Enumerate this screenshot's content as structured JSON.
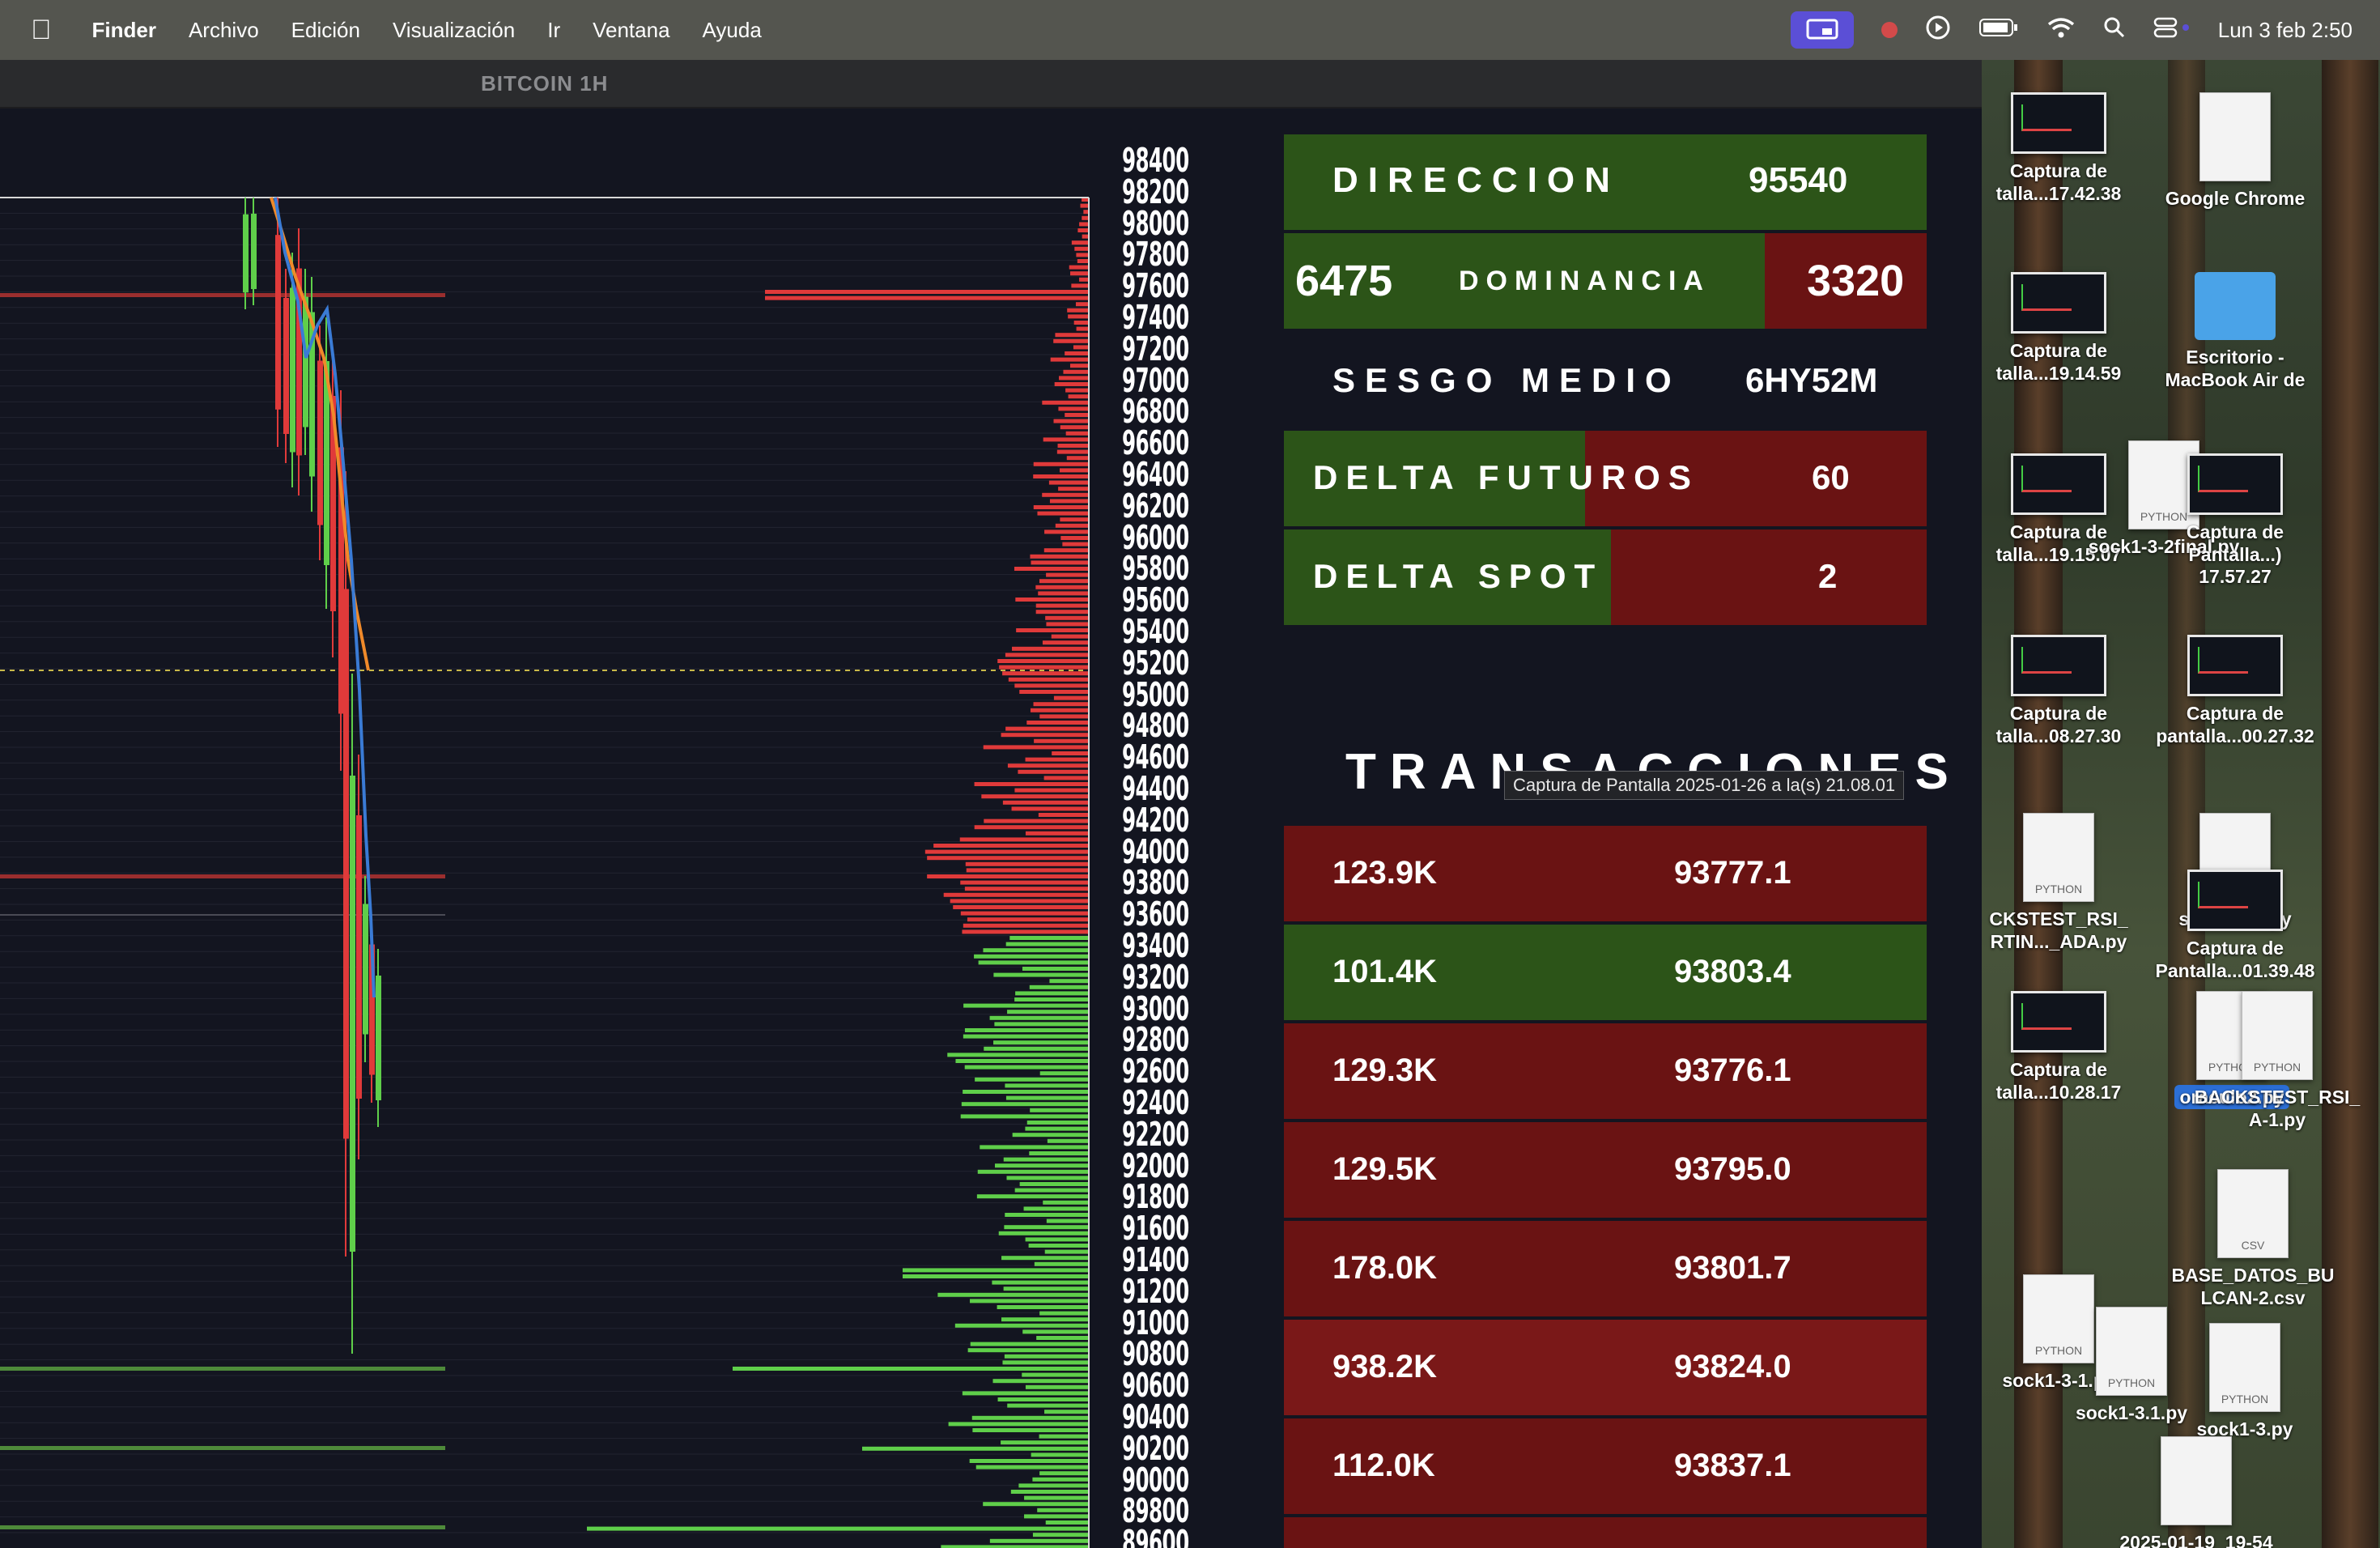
{
  "menubar": {
    "apple": "",
    "items": [
      "Finder",
      "Archivo",
      "Edición",
      "Visualización",
      "Ir",
      "Ventana",
      "Ayuda"
    ],
    "clock": "Lun 3 feb 2:50"
  },
  "window": {
    "title": "BITCOIN 1H"
  },
  "price_axis": [
    "98400",
    "98200",
    "98000",
    "97800",
    "97600",
    "97400",
    "97200",
    "97000",
    "96800",
    "96600",
    "96400",
    "96200",
    "96000",
    "95800",
    "95600",
    "95400",
    "95200",
    "95000",
    "94800",
    "94600",
    "94400",
    "94200",
    "94000",
    "93800",
    "93600",
    "93400",
    "93200",
    "93000",
    "92800",
    "92600",
    "92400",
    "92200",
    "92000",
    "91800",
    "91600",
    "91400",
    "91200",
    "91000",
    "90800",
    "90600",
    "90400",
    "90200",
    "90000",
    "89800",
    "89600"
  ],
  "panel": {
    "direccion_label": "DIRECCION",
    "direccion_value": "95540",
    "dominancia_left": "6475",
    "dominancia_label": "DOMINANCIA",
    "dominancia_right": "3320",
    "sesgo_label": "SESGO MEDIO",
    "sesgo_value": "6HY52M",
    "delta_futuros_label": "DELTA FUTUROS",
    "delta_futuros_value": "60",
    "delta_spot_label": "DELTA SPOT",
    "delta_spot_value": "2",
    "transacciones_title": "TRANSACCIONES"
  },
  "tooltip": "Captura de Pantalla 2025-01-26 a la(s) 21.08.01",
  "transactions": [
    {
      "qty": "123.9K",
      "price": "93777.1",
      "color": "#6a1313"
    },
    {
      "qty": "101.4K",
      "price": "93803.4",
      "color": "#2c5418"
    },
    {
      "qty": "129.3K",
      "price": "93776.1",
      "color": "#6a1313"
    },
    {
      "qty": "129.5K",
      "price": "93795.0",
      "color": "#6a1313"
    },
    {
      "qty": "178.0K",
      "price": "93801.7",
      "color": "#6a1313"
    },
    {
      "qty": "938.2K",
      "price": "93824.0",
      "color": "#7a1818"
    },
    {
      "qty": "112.0K",
      "price": "93837.1",
      "color": "#6a1313"
    }
  ],
  "desktop": {
    "icons": [
      {
        "label": "Captura de\ntalla...17.42.38",
        "kind": "thumb"
      },
      {
        "label": "Google Chrome",
        "kind": "doc"
      },
      {
        "label": "Captura de\ntalla...19.14.59",
        "kind": "thumb"
      },
      {
        "label": "Escritorio -\nMacBook Air de",
        "kind": "folder"
      },
      {
        "label": "Captura de\ntalla...19.15.07",
        "kind": "thumb"
      },
      {
        "label": "sock1-3-2final.py",
        "kind": "doc"
      },
      {
        "label": "Captura de\nPantalla...) 17.57.27",
        "kind": "thumb"
      },
      {
        "label": "Captura de\ntalla...08.27.30",
        "kind": "thumb"
      },
      {
        "label": "Captura de\npantalla...00.27.32",
        "kind": "thumb"
      },
      {
        "label": "CKSTEST_RSI_\nRTIN..._ADA.py",
        "kind": "doc"
      },
      {
        "label": "sock1-2-1.py",
        "kind": "doc"
      },
      {
        "label": "Captura de\nPantalla...01.39.48",
        "kind": "thumb"
      },
      {
        "label": "Captura de\ntalla...10.28.17",
        "kind": "thumb"
      },
      {
        "label": "oraculo2.py",
        "kind": "doc"
      },
      {
        "label": "BACKSTEST_RSI_\nA-1.py",
        "kind": "doc"
      },
      {
        "label": "BASE_DATOS_BU\nLCAN-2.csv",
        "kind": "doc"
      },
      {
        "label": "sock1-3-1.py",
        "kind": "doc"
      },
      {
        "label": "sock1-3.1.py",
        "kind": "doc"
      },
      {
        "label": "sock1-3.py",
        "kind": "doc"
      },
      {
        "label": "2025-01-19_19-54",
        "kind": "doc"
      }
    ],
    "doc_tags": {
      "python": "PYTHON",
      "csv": "CSV"
    }
  },
  "colors": {
    "bull": "#5fcf4a",
    "bear": "#e03a3a",
    "ema_orange": "#f08a2a",
    "ema_blue": "#3a7bd5"
  }
}
